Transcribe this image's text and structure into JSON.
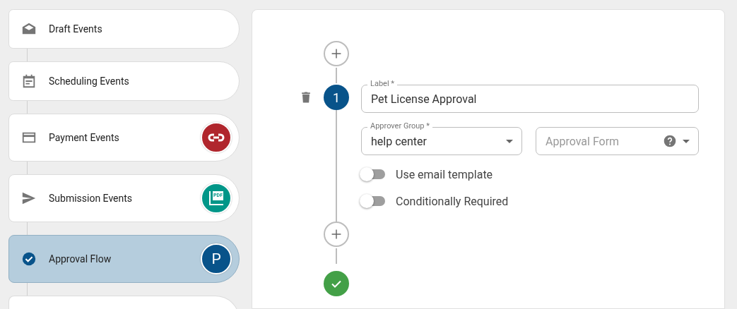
{
  "sidebar": {
    "items": [
      {
        "kind": "envelope",
        "label": "Draft Events",
        "selected": false
      },
      {
        "kind": "calendar",
        "label": "Scheduling Events",
        "selected": false
      },
      {
        "kind": "card",
        "label": "Payment Events",
        "selected": false,
        "badge": {
          "kind": "link",
          "color": "#b0262d"
        }
      },
      {
        "kind": "send",
        "label": "Submission Events",
        "selected": false,
        "badge": {
          "kind": "pdf",
          "text": "PDF",
          "color": "#009688"
        }
      },
      {
        "kind": "check",
        "label": "Approval Flow",
        "selected": true,
        "badge": {
          "kind": "letter",
          "text": "P",
          "color": "#08538a"
        }
      },
      {
        "kind": "partial"
      }
    ]
  },
  "flow": {
    "step": {
      "number": "1",
      "label_field": {
        "label": "Label *",
        "value": "Pet License Approval"
      },
      "approver_group": {
        "label": "Approver Group *",
        "value": "help center"
      },
      "approval_form": {
        "placeholder": "Approval Form"
      },
      "toggles": [
        {
          "label": "Use email template",
          "on": false
        },
        {
          "label": "Conditionally Required",
          "on": false
        }
      ]
    }
  }
}
